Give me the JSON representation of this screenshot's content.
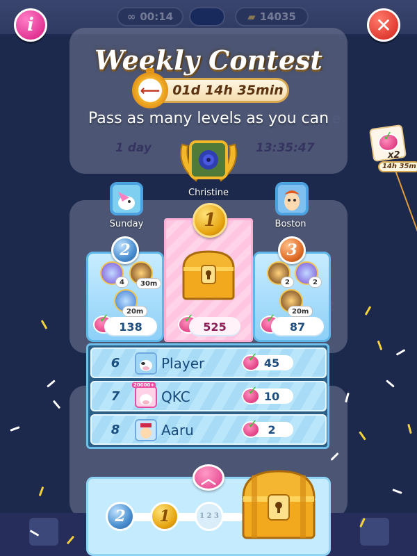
{
  "background": {
    "lives_value": "00:14",
    "gold_value": "14035",
    "event_card_duration": "1 day",
    "event_card_time": "13:35:47",
    "event_card_subtitle_tail": "e",
    "partial_text_right": "t"
  },
  "header": {
    "title": "Weekly Contest",
    "timer": "01d 14h 35min",
    "subtitle": "Pass as many levels as you can"
  },
  "buttons": {
    "info_label": "i",
    "close_label": "✕",
    "up_label": "︿"
  },
  "podium": {
    "first": {
      "name": "Christine",
      "rank": "1",
      "score": "525"
    },
    "second": {
      "name": "Sunday",
      "rank": "2",
      "score": "138",
      "boosters": [
        {
          "icon": "lollipop-hammer-booster-icon",
          "count": "4"
        },
        {
          "icon": "color-bomb-booster-icon",
          "count": "30m"
        },
        {
          "icon": "striped-wrapped-booster-icon",
          "count": "20m"
        }
      ]
    },
    "third": {
      "name": "Boston",
      "rank": "3",
      "score": "87",
      "boosters": [
        {
          "icon": "color-bomb-booster-icon",
          "count": "2"
        },
        {
          "icon": "lollipop-hammer-booster-icon",
          "count": "2"
        },
        {
          "icon": "color-bomb-timed-booster-icon",
          "count": "20m"
        }
      ]
    }
  },
  "leaderboard": {
    "rows": [
      {
        "rank": "6",
        "name": "Player",
        "score": "45",
        "avatar": "player-avatar",
        "tag": ""
      },
      {
        "rank": "7",
        "name": "QKC",
        "score": "10",
        "avatar": "qkc-avatar",
        "tag": "20000+"
      },
      {
        "rank": "8",
        "name": "Aaru",
        "score": "2",
        "avatar": "aaru-avatar",
        "tag": ""
      }
    ]
  },
  "progress": {
    "milestones": [
      "2",
      "1",
      "1 2 3"
    ]
  },
  "offer": {
    "multiplier": "x2",
    "time": "14h 35m"
  },
  "colors": {
    "background": "#27375f",
    "gold": "#e6a40f",
    "silver": "#4a8fd0",
    "bronze": "#e2702a",
    "pink_card": "#ffc5e1",
    "blue_card": "#8dd0f7"
  }
}
